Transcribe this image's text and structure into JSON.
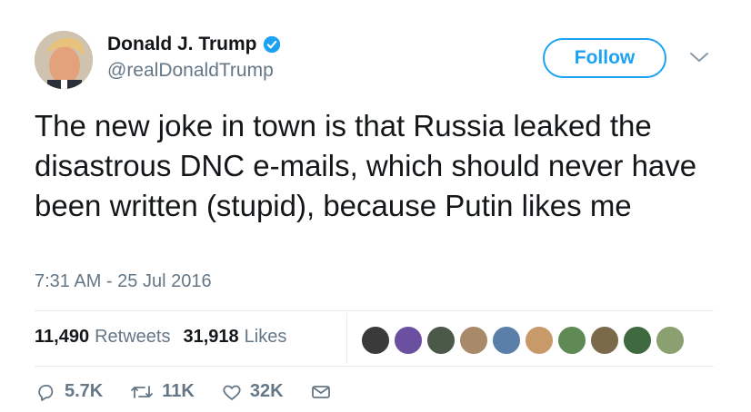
{
  "author": {
    "name": "Donald J. Trump",
    "handle": "@realDonaldTrump",
    "verified": true
  },
  "follow_button": {
    "label": "Follow",
    "color": "#1da1f2"
  },
  "tweet": {
    "text": "The new joke in town is that Russia leaked the disastrous DNC e-mails, which should never have been written (stupid), because Putin likes me",
    "timestamp": "7:31 AM - 25 Jul 2016"
  },
  "stats": {
    "retweets_count": "11,490",
    "retweets_label": "Retweets",
    "likes_count": "31,918",
    "likes_label": "Likes"
  },
  "likers": [
    {
      "icon": "liker-avatar"
    },
    {
      "icon": "liker-avatar"
    },
    {
      "icon": "liker-avatar"
    },
    {
      "icon": "liker-avatar"
    },
    {
      "icon": "liker-avatar"
    },
    {
      "icon": "liker-avatar"
    },
    {
      "icon": "liker-avatar"
    },
    {
      "icon": "liker-avatar"
    },
    {
      "icon": "liker-avatar"
    },
    {
      "icon": "liker-avatar"
    }
  ],
  "actions": {
    "replies": "5.7K",
    "retweets": "11K",
    "likes": "32K"
  }
}
